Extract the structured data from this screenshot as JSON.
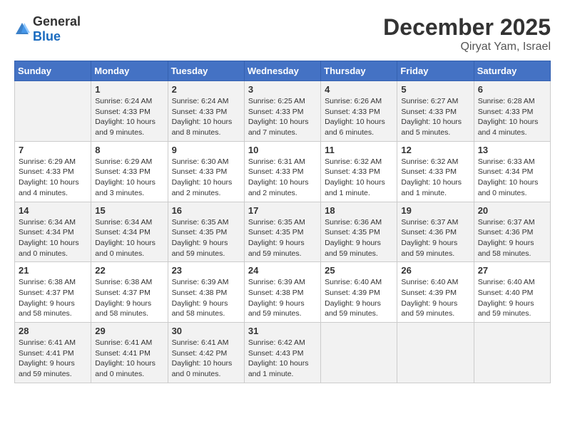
{
  "header": {
    "logo_general": "General",
    "logo_blue": "Blue",
    "month_title": "December 2025",
    "location": "Qiryat Yam, Israel"
  },
  "days_of_week": [
    "Sunday",
    "Monday",
    "Tuesday",
    "Wednesday",
    "Thursday",
    "Friday",
    "Saturday"
  ],
  "weeks": [
    [
      {
        "day": "",
        "info": ""
      },
      {
        "day": "1",
        "info": "Sunrise: 6:24 AM\nSunset: 4:33 PM\nDaylight: 10 hours\nand 9 minutes."
      },
      {
        "day": "2",
        "info": "Sunrise: 6:24 AM\nSunset: 4:33 PM\nDaylight: 10 hours\nand 8 minutes."
      },
      {
        "day": "3",
        "info": "Sunrise: 6:25 AM\nSunset: 4:33 PM\nDaylight: 10 hours\nand 7 minutes."
      },
      {
        "day": "4",
        "info": "Sunrise: 6:26 AM\nSunset: 4:33 PM\nDaylight: 10 hours\nand 6 minutes."
      },
      {
        "day": "5",
        "info": "Sunrise: 6:27 AM\nSunset: 4:33 PM\nDaylight: 10 hours\nand 5 minutes."
      },
      {
        "day": "6",
        "info": "Sunrise: 6:28 AM\nSunset: 4:33 PM\nDaylight: 10 hours\nand 4 minutes."
      }
    ],
    [
      {
        "day": "7",
        "info": "Sunrise: 6:29 AM\nSunset: 4:33 PM\nDaylight: 10 hours\nand 4 minutes."
      },
      {
        "day": "8",
        "info": "Sunrise: 6:29 AM\nSunset: 4:33 PM\nDaylight: 10 hours\nand 3 minutes."
      },
      {
        "day": "9",
        "info": "Sunrise: 6:30 AM\nSunset: 4:33 PM\nDaylight: 10 hours\nand 2 minutes."
      },
      {
        "day": "10",
        "info": "Sunrise: 6:31 AM\nSunset: 4:33 PM\nDaylight: 10 hours\nand 2 minutes."
      },
      {
        "day": "11",
        "info": "Sunrise: 6:32 AM\nSunset: 4:33 PM\nDaylight: 10 hours\nand 1 minute."
      },
      {
        "day": "12",
        "info": "Sunrise: 6:32 AM\nSunset: 4:33 PM\nDaylight: 10 hours\nand 1 minute."
      },
      {
        "day": "13",
        "info": "Sunrise: 6:33 AM\nSunset: 4:34 PM\nDaylight: 10 hours\nand 0 minutes."
      }
    ],
    [
      {
        "day": "14",
        "info": "Sunrise: 6:34 AM\nSunset: 4:34 PM\nDaylight: 10 hours\nand 0 minutes."
      },
      {
        "day": "15",
        "info": "Sunrise: 6:34 AM\nSunset: 4:34 PM\nDaylight: 10 hours\nand 0 minutes."
      },
      {
        "day": "16",
        "info": "Sunrise: 6:35 AM\nSunset: 4:35 PM\nDaylight: 9 hours\nand 59 minutes."
      },
      {
        "day": "17",
        "info": "Sunrise: 6:35 AM\nSunset: 4:35 PM\nDaylight: 9 hours\nand 59 minutes."
      },
      {
        "day": "18",
        "info": "Sunrise: 6:36 AM\nSunset: 4:35 PM\nDaylight: 9 hours\nand 59 minutes."
      },
      {
        "day": "19",
        "info": "Sunrise: 6:37 AM\nSunset: 4:36 PM\nDaylight: 9 hours\nand 59 minutes."
      },
      {
        "day": "20",
        "info": "Sunrise: 6:37 AM\nSunset: 4:36 PM\nDaylight: 9 hours\nand 58 minutes."
      }
    ],
    [
      {
        "day": "21",
        "info": "Sunrise: 6:38 AM\nSunset: 4:37 PM\nDaylight: 9 hours\nand 58 minutes."
      },
      {
        "day": "22",
        "info": "Sunrise: 6:38 AM\nSunset: 4:37 PM\nDaylight: 9 hours\nand 58 minutes."
      },
      {
        "day": "23",
        "info": "Sunrise: 6:39 AM\nSunset: 4:38 PM\nDaylight: 9 hours\nand 58 minutes."
      },
      {
        "day": "24",
        "info": "Sunrise: 6:39 AM\nSunset: 4:38 PM\nDaylight: 9 hours\nand 59 minutes."
      },
      {
        "day": "25",
        "info": "Sunrise: 6:40 AM\nSunset: 4:39 PM\nDaylight: 9 hours\nand 59 minutes."
      },
      {
        "day": "26",
        "info": "Sunrise: 6:40 AM\nSunset: 4:39 PM\nDaylight: 9 hours\nand 59 minutes."
      },
      {
        "day": "27",
        "info": "Sunrise: 6:40 AM\nSunset: 4:40 PM\nDaylight: 9 hours\nand 59 minutes."
      }
    ],
    [
      {
        "day": "28",
        "info": "Sunrise: 6:41 AM\nSunset: 4:41 PM\nDaylight: 9 hours\nand 59 minutes."
      },
      {
        "day": "29",
        "info": "Sunrise: 6:41 AM\nSunset: 4:41 PM\nDaylight: 10 hours\nand 0 minutes."
      },
      {
        "day": "30",
        "info": "Sunrise: 6:41 AM\nSunset: 4:42 PM\nDaylight: 10 hours\nand 0 minutes."
      },
      {
        "day": "31",
        "info": "Sunrise: 6:42 AM\nSunset: 4:43 PM\nDaylight: 10 hours\nand 1 minute."
      },
      {
        "day": "",
        "info": ""
      },
      {
        "day": "",
        "info": ""
      },
      {
        "day": "",
        "info": ""
      }
    ]
  ]
}
